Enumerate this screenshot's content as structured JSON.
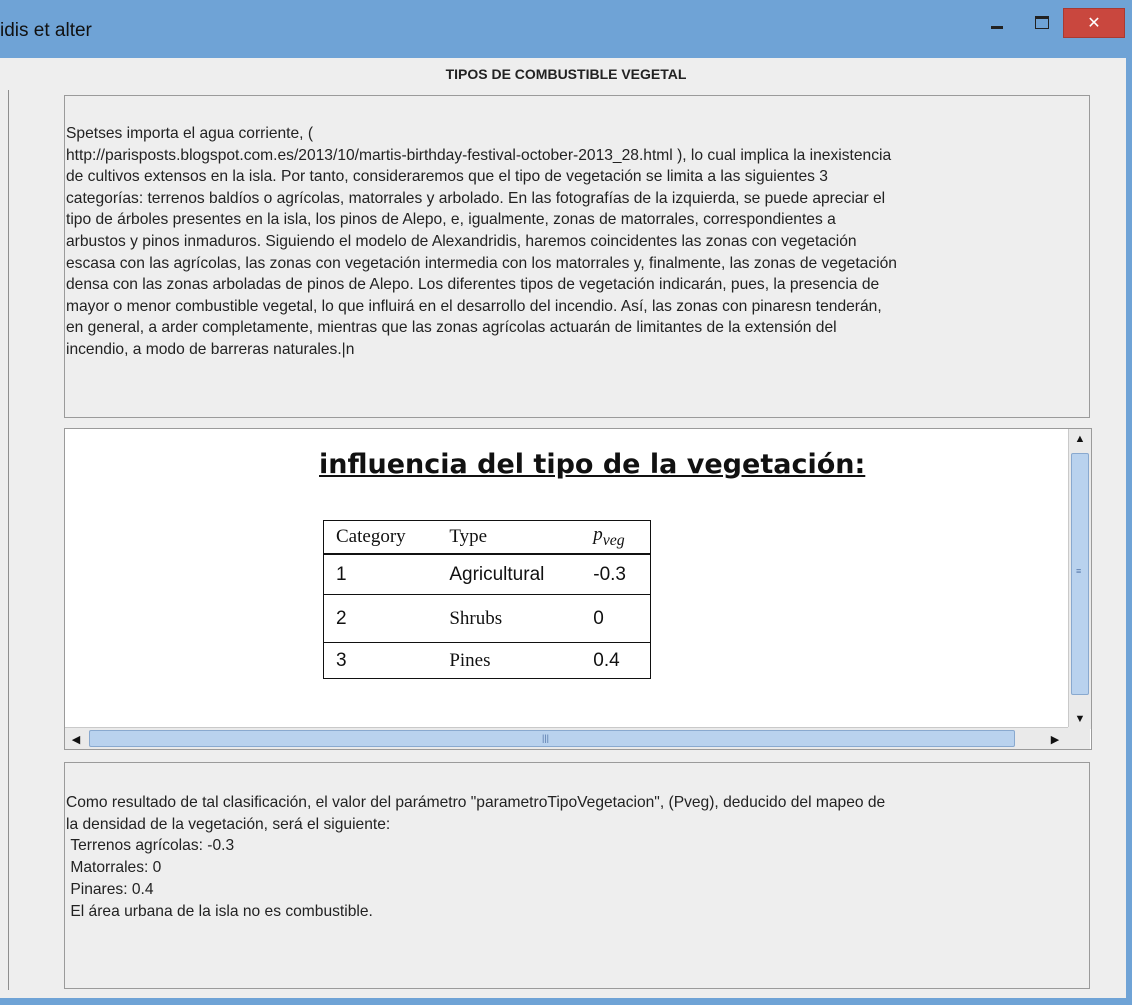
{
  "window": {
    "title": "idis et alter",
    "controls": {
      "minimize": "minimize",
      "maximize": "maximize",
      "close": "✕"
    }
  },
  "heading": "TIPOS DE COMBUSTIBLE VEGETAL",
  "intro_text": "Spetses importa el agua corriente, (\nhttp://parisposts.blogspot.com.es/2013/10/martis-birthday-festival-october-2013_28.html ), lo cual implica la inexistencia\nde cultivos extensos en la isla. Por tanto, consideraremos que el tipo de vegetación se limita a las siguientes 3\ncategorías: terrenos baldíos o agrícolas, matorrales y arbolado. En las fotografías de la izquierda, se puede apreciar el\ntipo de árboles presentes en la isla, los pinos de Alepo, e, igualmente, zonas de matorrales, correspondientes a\narbustos y pinos inmaduros. Siguiendo el modelo de Alexandridis, haremos coincidentes las zonas con vegetación\nescasa con las agrícolas, las zonas con vegetación intermedia con los matorrales y, finalmente, las zonas de vegetación\ndensa con las zonas arboladas de pinos de Alepo. Los diferentes tipos de vegetación indicarán, pues, la presencia de\nmayor o menor combustible vegetal, lo que influirá en el desarrollo del incendio. Así, las zonas con pinaresn tenderán,\nen general, a arder completamente, mientras que las zonas agrícolas actuarán de limitantes de la extensión del\nincendio, a modo de barreras naturales.|n",
  "image": {
    "title": "influencia del tipo de la vegetación:",
    "table": {
      "headers": {
        "category": "Category",
        "type": "Type",
        "p": "p",
        "p_sub": "veg"
      },
      "rows": [
        {
          "category": "1",
          "type": "Agricultural",
          "value": "-0.3"
        },
        {
          "category": "2",
          "type": "Shrubs",
          "value": "0"
        },
        {
          "category": "3",
          "type": "Pines",
          "value": "0.4"
        }
      ]
    }
  },
  "scrollbars": {
    "up_arrow": "▲",
    "down_arrow": "▼",
    "left_arrow": "◀",
    "right_arrow": "▶",
    "vertical_grip": "≡",
    "horizontal_grip": "|||"
  },
  "result_text": "Como resultado de tal clasificación, el valor del parámetro \"parametroTipoVegetacion\", (Pveg), deducido del mapeo de\nla densidad de la vegetación, será el siguiente:\n Terrenos agrícolas: -0.3\n Matorrales: 0\n Pinares: 0.4\n El área urbana de la isla no es combustible."
}
